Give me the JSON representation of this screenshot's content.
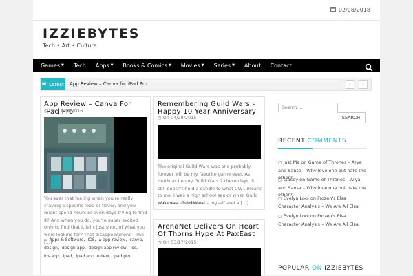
{
  "header": {
    "date": "02/08/2018",
    "site_title": "IZZIEBYTES",
    "tagline": "Tech • Art • Culture"
  },
  "nav": {
    "items": [
      {
        "label": "Games",
        "dropdown": true
      },
      {
        "label": "Tech",
        "dropdown": false
      },
      {
        "label": "Apps",
        "dropdown": true
      },
      {
        "label": "Books & Comics",
        "dropdown": true
      },
      {
        "label": "Movies",
        "dropdown": true
      },
      {
        "label": "Series",
        "dropdown": true
      },
      {
        "label": "About",
        "dropdown": false
      },
      {
        "label": "Contact",
        "dropdown": false
      }
    ],
    "search_icon": "search-icon"
  },
  "ticker": {
    "badge": "Latest",
    "text": "App Review – Canva for iPad Pro",
    "prev": "‹",
    "next": "›"
  },
  "posts": {
    "p1": {
      "title": "App Review – Canva For IPad Pro",
      "date": "On 11/04/2016",
      "excerpt": "You ever that feeling when you're really craving a specific food or flavor, and you might spend hours or even days trying to find it? And when you do, you're super excited only to find that it falls just short of what you were looking for? That disappointment – The […]",
      "category": "Apps & Software",
      "tags": [
        "IOS",
        "app review",
        "canva",
        "design",
        "design app",
        "design app review",
        "ios",
        "ios app",
        "ipad",
        "ipad app review",
        "ipad pro"
      ]
    },
    "p2": {
      "title": "Remembering Guild Wars – Happy 10 Year Anniversary",
      "date": "On 04/28/2015",
      "excerpt": "The original Guild Wars was and probably forever will be my favorite game ever. As much as I enjoy Guild Wars 2 these days, it still doesn't hold a candle to what GW1 meant to me. I was a high school senior when Guild Wars was announced – myself and a […]",
      "category": "Games",
      "tags": [
        "Guild Wars"
      ]
    },
    "p3": {
      "title": "ArenaNet Delivers On Heart Of Thorns Hype At PaxEast",
      "date": "On 03/17/2015"
    }
  },
  "sidebar": {
    "search_placeholder": "Search …",
    "search_button": "SEARCH",
    "recent_prefix": "RECENT",
    "recent_accent": "COMMENTS",
    "comments": [
      {
        "author": "just Me",
        "post": "Game of Thrones – Arya and Sansa – Why love one but hate the other?"
      },
      {
        "author": "stacey",
        "post": "Game of Thrones – Arya and Sansa – Why love one but hate the other?"
      },
      {
        "author": "Evelyn Looi",
        "post": "Frozen's Elsa Character Analysis – We Are All Elsa"
      },
      {
        "author": "Evelyn Looi",
        "post": "Frozen's Elsa Character Analysis – We Are All Elsa"
      }
    ],
    "comment_joiner": "on",
    "popular_prefix": "POPULAR",
    "popular_on": "ON",
    "popular_accent": "IZZIEBYTES"
  },
  "colors": {
    "accent": "#24b9c6",
    "nav_bg": "#000000"
  }
}
